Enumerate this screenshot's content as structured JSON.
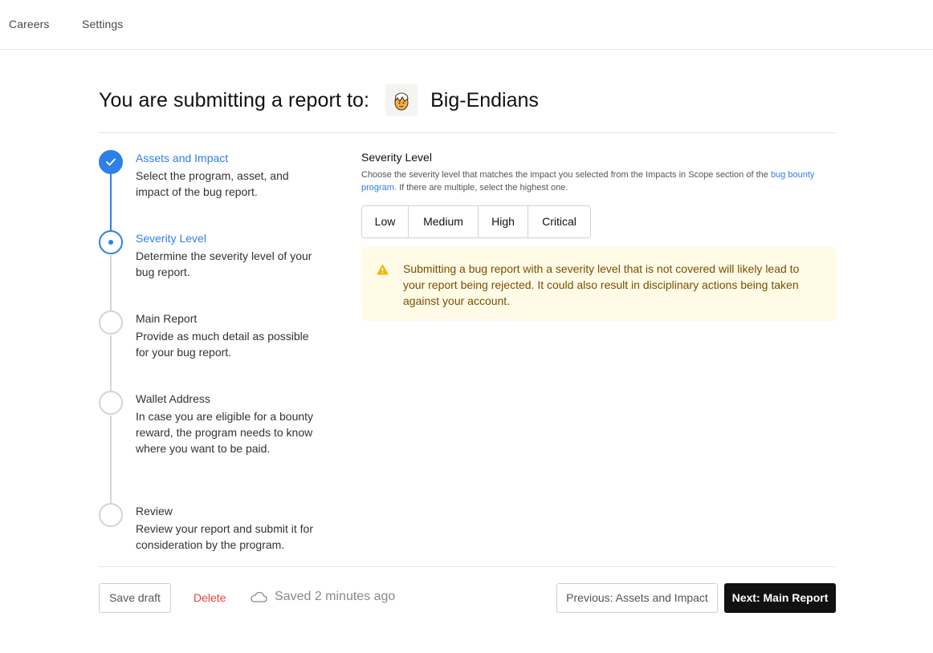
{
  "topnav": {
    "careers": "Careers",
    "settings": "Settings"
  },
  "header": {
    "title": "You are submitting a report to:",
    "program_name": "Big-Endians",
    "logo_icon": "egg-hatching-icon"
  },
  "steps": [
    {
      "title": "Assets and Impact",
      "desc": "Select the program, asset, and impact of the bug report.",
      "state": "done"
    },
    {
      "title": "Severity Level",
      "desc": "Determine the severity level of your bug report.",
      "state": "active"
    },
    {
      "title": "Main Report",
      "desc": "Provide as much detail as possible for your bug report.",
      "state": "pending"
    },
    {
      "title": "Wallet Address",
      "desc": "In case you are eligible for a bounty reward, the program needs to know where you want to be paid.",
      "state": "pending"
    },
    {
      "title": "Review",
      "desc": "Review your report and submit it for consideration by the program.",
      "state": "pending"
    }
  ],
  "severity": {
    "label": "Severity Level",
    "help_prefix": "Choose the severity level that matches the impact you selected from the Impacts in Scope section of the ",
    "help_link": "bug bounty program.",
    "help_suffix": " If there are multiple, select the highest one.",
    "options": [
      "Low",
      "Medium",
      "High",
      "Critical"
    ]
  },
  "warning": {
    "icon": "warning-triangle-icon",
    "text": "Submitting a bug report with a severity level that is not covered will likely lead to your report being rejected. It could also result in disciplinary actions being taken against your account."
  },
  "footer": {
    "save_draft": "Save draft",
    "delete": "Delete",
    "saved_status": "Saved 2 minutes ago",
    "previous": "Previous: Assets and Impact",
    "next": "Next: Main Report"
  },
  "colors": {
    "accent": "#2f7fe8",
    "danger": "#e5453a",
    "warning_bg": "#fffbe6",
    "warning_text": "#7a4e00",
    "primary_button": "#111111"
  }
}
